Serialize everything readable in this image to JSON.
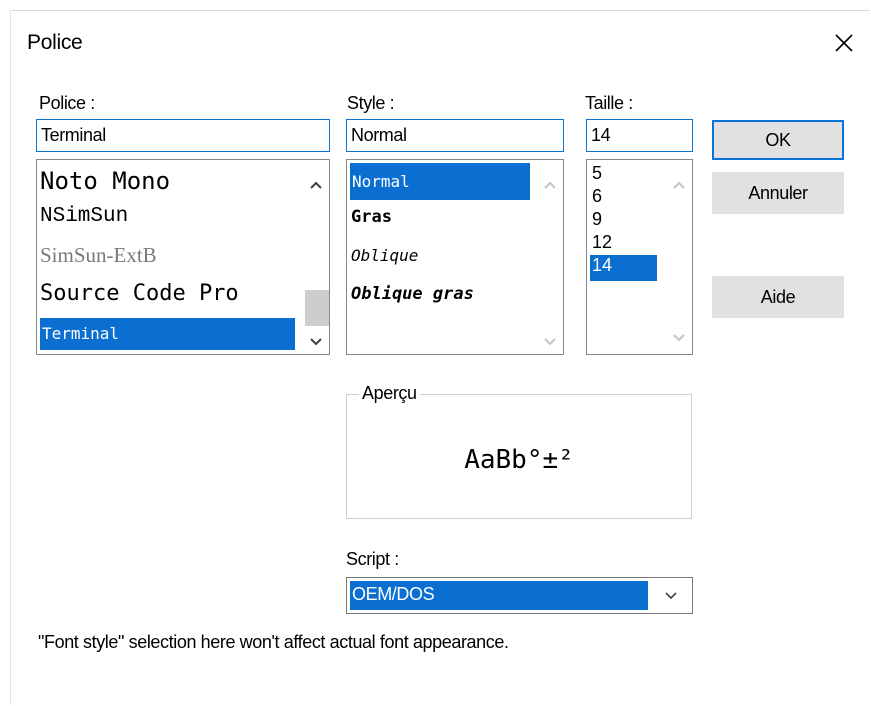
{
  "dialog": {
    "title": "Police"
  },
  "font": {
    "label": "Police :",
    "value": "Terminal",
    "items": [
      "Noto Mono",
      "NSimSun",
      "SimSun-ExtB",
      "Source Code Pro",
      "Terminal"
    ],
    "selected": "Terminal"
  },
  "style": {
    "label": "Style :",
    "value": "Normal",
    "items": [
      "Normal",
      "Gras",
      "Oblique",
      "Oblique gras"
    ],
    "selected": "Normal"
  },
  "size": {
    "label": "Taille :",
    "value": "14",
    "items": [
      "5",
      "6",
      "9",
      "12",
      "14"
    ],
    "selected": "14"
  },
  "buttons": {
    "ok": "OK",
    "cancel": "Annuler",
    "help": "Aide"
  },
  "preview": {
    "label": "Aperçu",
    "sample": "AaBb°±²"
  },
  "script": {
    "label": "Script :",
    "value": "OEM/DOS"
  },
  "note": "\"Font style\" selection here won't affect actual font appearance.",
  "icons": [
    "close-icon",
    "chevron-up-icon",
    "chevron-down-icon"
  ],
  "colors": {
    "accent": "#0a74d9",
    "selection": "#0a6fd1",
    "button_face": "#e1e1e1",
    "disabled_text": "#7a7a7a"
  }
}
